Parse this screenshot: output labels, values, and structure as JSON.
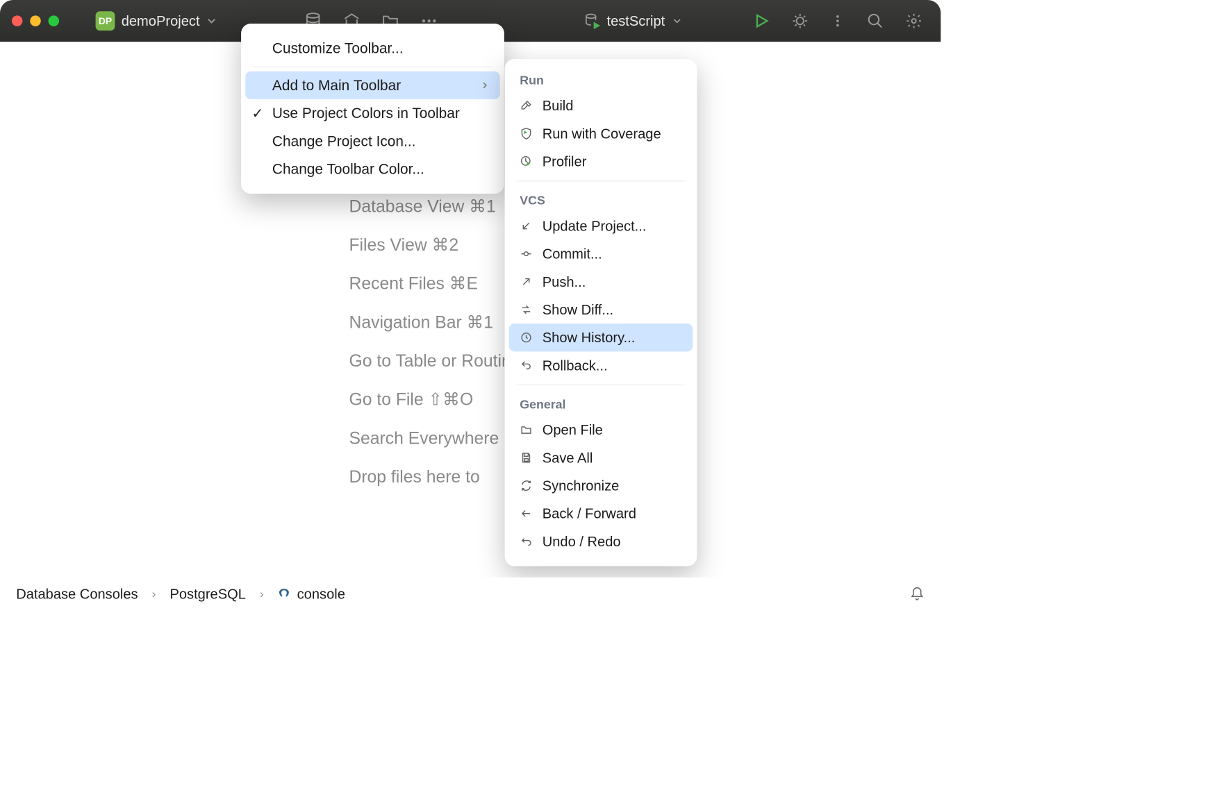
{
  "titlebar": {
    "project_badge": "DP",
    "project_name": "demoProject",
    "run_config_name": "testScript"
  },
  "welcome_hints": [
    "Database View ⌘1",
    "Files View ⌘2",
    "Recent Files ⌘E",
    "Navigation Bar ⌘1",
    "Go to Table or Routine",
    "Go to File ⇧⌘O",
    "Search Everywhere",
    "Drop files here to"
  ],
  "context_menu": {
    "items": [
      {
        "label": "Customize Toolbar..."
      },
      {
        "label": "Add to Main Toolbar",
        "submenu": true,
        "highlighted": true
      },
      {
        "label": "Use Project Colors in Toolbar",
        "checked": true
      },
      {
        "label": "Change Project Icon..."
      },
      {
        "label": "Change Toolbar Color..."
      }
    ]
  },
  "submenu": {
    "groups": [
      {
        "title": "Run",
        "items": [
          {
            "label": "Build",
            "icon": "hammer"
          },
          {
            "label": "Run with Coverage",
            "icon": "shield-play"
          },
          {
            "label": "Profiler",
            "icon": "clock-play"
          }
        ]
      },
      {
        "title": "VCS",
        "items": [
          {
            "label": "Update Project...",
            "icon": "arrow-down-left"
          },
          {
            "label": "Commit...",
            "icon": "commit-dot"
          },
          {
            "label": "Push...",
            "icon": "arrow-up-right"
          },
          {
            "label": "Show Diff...",
            "icon": "diff-arrows"
          },
          {
            "label": "Show History...",
            "icon": "clock",
            "highlighted": true
          },
          {
            "label": "Rollback...",
            "icon": "undo"
          }
        ]
      },
      {
        "title": "General",
        "items": [
          {
            "label": "Open File",
            "icon": "folder"
          },
          {
            "label": "Save All",
            "icon": "save"
          },
          {
            "label": "Synchronize",
            "icon": "sync"
          },
          {
            "label": "Back / Forward",
            "icon": "arrow-left"
          },
          {
            "label": "Undo / Redo",
            "icon": "undo-curve"
          }
        ]
      }
    ]
  },
  "breadcrumb": {
    "items": [
      "Database Consoles",
      "PostgreSQL",
      "console"
    ]
  }
}
